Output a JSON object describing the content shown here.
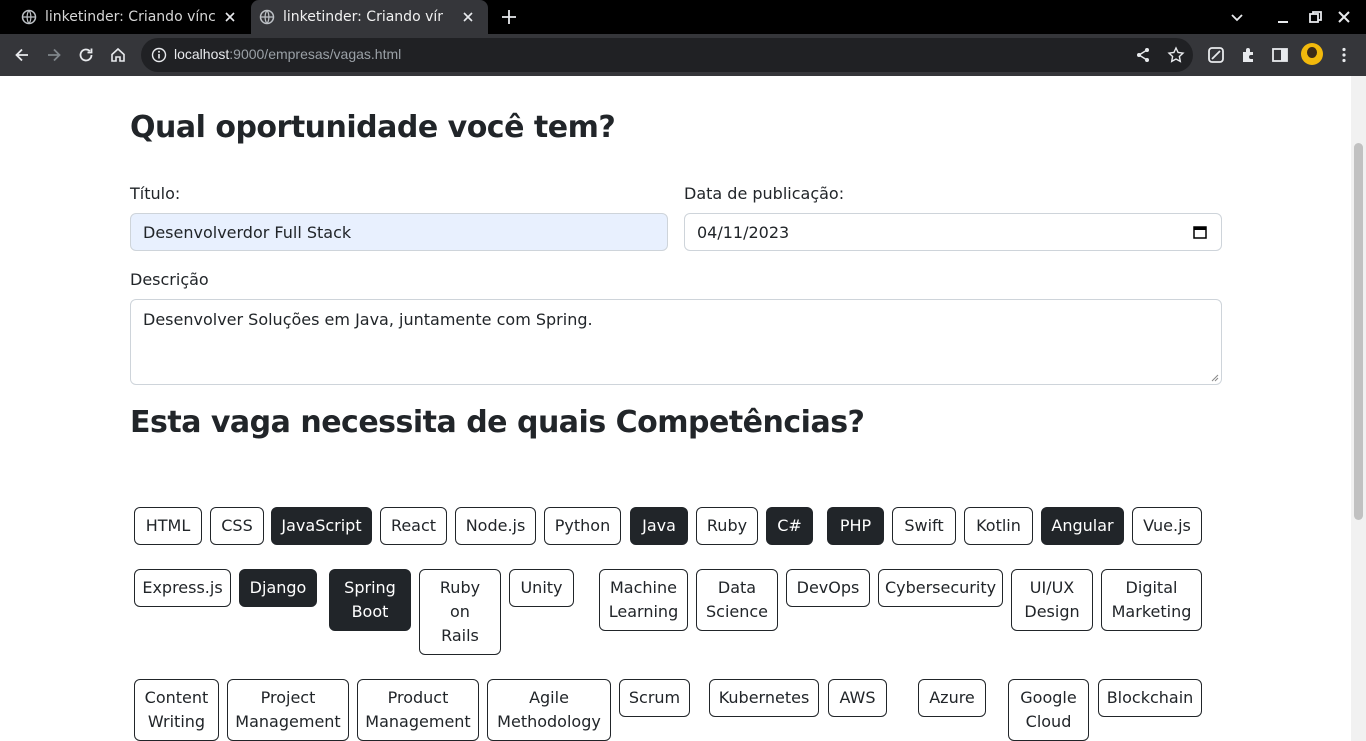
{
  "browser": {
    "tabs": [
      {
        "title": "linketinder: Criando víncu"
      },
      {
        "title": "linketinder: Criando víncu"
      }
    ],
    "url": {
      "host": "localhost",
      "path": ":9000/empresas/vagas.html"
    }
  },
  "form": {
    "heading": "Qual oportunidade você tem?",
    "titulo_label": "Título:",
    "titulo_value": "Desenvolverdor Full Stack",
    "data_label": "Data de publicação:",
    "data_value": "04/11/2023",
    "descricao_label": "Descrição",
    "descricao_value": "Desenvolver Soluções em Java, juntamente com Spring."
  },
  "skills": {
    "heading": "Esta vaga necessita de quais Competências?",
    "items": [
      {
        "label": "HTML",
        "selected": false
      },
      {
        "label": "CSS",
        "selected": false
      },
      {
        "label": "JavaScript",
        "selected": true
      },
      {
        "label": "React",
        "selected": false
      },
      {
        "label": "Node.js",
        "selected": false
      },
      {
        "label": "Python",
        "selected": false
      },
      {
        "label": "Java",
        "selected": true
      },
      {
        "label": "Ruby",
        "selected": false
      },
      {
        "label": "C#",
        "selected": true
      },
      {
        "label": "PHP",
        "selected": true
      },
      {
        "label": "Swift",
        "selected": false
      },
      {
        "label": "Kotlin",
        "selected": false
      },
      {
        "label": "Angular",
        "selected": true
      },
      {
        "label": "Vue.js",
        "selected": false
      },
      {
        "label": "Express.js",
        "selected": false
      },
      {
        "label": "Django",
        "selected": true
      },
      {
        "label": "Spring\nBoot",
        "selected": true
      },
      {
        "label": "Ruby\non\nRails",
        "selected": false
      },
      {
        "label": "Unity",
        "selected": false
      },
      {
        "label": "Machine\nLearning",
        "selected": false
      },
      {
        "label": "Data\nScience",
        "selected": false
      },
      {
        "label": "DevOps",
        "selected": false
      },
      {
        "label": "Cybersecurity",
        "selected": false
      },
      {
        "label": "UI/UX\nDesign",
        "selected": false
      },
      {
        "label": "Digital\nMarketing",
        "selected": false
      },
      {
        "label": "Content\nWriting",
        "selected": false
      },
      {
        "label": "Project\nManagement",
        "selected": false
      },
      {
        "label": "Product\nManagement",
        "selected": false
      },
      {
        "label": "Agile\nMethodology",
        "selected": false
      },
      {
        "label": "Scrum",
        "selected": false
      },
      {
        "label": "Kubernetes",
        "selected": false
      },
      {
        "label": "AWS",
        "selected": false
      },
      {
        "label": "Azure",
        "selected": false
      },
      {
        "label": "Google\nCloud",
        "selected": false
      },
      {
        "label": "Blockchain",
        "selected": false
      }
    ]
  },
  "colors": {
    "selected_bg": "#212529",
    "autofill_bg": "#e8f0fe",
    "chrome_tabbar": "#000000",
    "chrome_toolbar": "#35363a"
  },
  "icons": [
    "globe-icon",
    "close-icon",
    "plus-icon",
    "back-icon",
    "forward-icon",
    "reload-icon",
    "home-icon",
    "info-icon",
    "share-icon",
    "star-icon",
    "extensions-icon",
    "calendar-icon"
  ]
}
